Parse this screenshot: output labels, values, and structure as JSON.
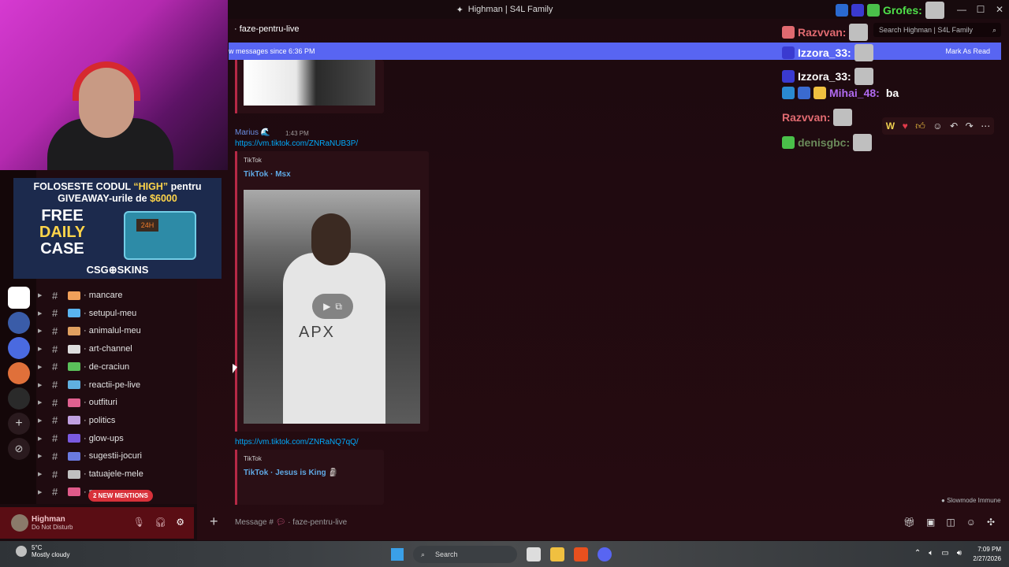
{
  "window": {
    "title": "Highman | S4L Family"
  },
  "header": {
    "channel": "faze-pentru-live",
    "search_placeholder": "Search Highman | S4L Family"
  },
  "banner": {
    "text": "w messages since 6:36 PM",
    "action": "Mark As Read"
  },
  "channels": [
    {
      "name": "mancare",
      "color": "#f0a05a"
    },
    {
      "name": "setupul-meu",
      "color": "#5ab4f0"
    },
    {
      "name": "animalul-meu",
      "color": "#e0a060"
    },
    {
      "name": "art-channel",
      "color": "#dddddd"
    },
    {
      "name": "de-craciun",
      "color": "#5ac05a"
    },
    {
      "name": "reactii-pe-live",
      "color": "#60b0e0"
    },
    {
      "name": "outfituri",
      "color": "#e06090"
    },
    {
      "name": "politics",
      "color": "#c0a0e0"
    },
    {
      "name": "glow-ups",
      "color": "#7a5ae0"
    },
    {
      "name": "sugestii-jocuri",
      "color": "#6a7ae0"
    },
    {
      "name": "tatuajele-mele",
      "color": "#c0c0c0"
    },
    {
      "name": "m",
      "color": "#e05a8a"
    }
  ],
  "mentions_badge": "2 NEW MENTIONS",
  "user": {
    "name": "Highman",
    "status": "Do Not Disturb"
  },
  "ad": {
    "line1_pre": "FOLOSESTE CODUL ",
    "line1_code": "“HIGH”",
    "line1_post": " pentru",
    "line2_pre": "GIVEAWAY-urile de ",
    "line2_amount": "$6000",
    "free": "FREE",
    "daily": "DAILY",
    "case": "CASE",
    "timer": "24H",
    "brand": "CSG⊕SKINS"
  },
  "messages": {
    "author": "Marius",
    "time": "1:43 PM",
    "link1": "https://vm.tiktok.com/ZNRaNUB3P/",
    "provider1": "TikTok",
    "title1": "TikTok · Msx",
    "link2": "https://vm.tiktok.com/ZNRaNQ7qQ/",
    "provider2": "TikTok",
    "title2": "TikTok · Jesus is King"
  },
  "video": {
    "suit_text": "APX"
  },
  "chat_overlay": [
    {
      "user": "Grofes:",
      "color": "#4fe04a",
      "text": ""
    },
    {
      "user": "Razvvan:",
      "color": "#e06a70",
      "text": ""
    },
    {
      "user": "Izzora_33:",
      "color": "#ffffff",
      "text": ""
    },
    {
      "user": "Izzora_33:",
      "color": "#ffffff",
      "text": ""
    },
    {
      "user": "Mihai_48:",
      "color": "#b06af0",
      "text": "ba"
    },
    {
      "user": "Razvvan:",
      "color": "#e06a70",
      "text": ""
    },
    {
      "user": "denisgbc:",
      "color": "#6a8a5a",
      "text": ""
    }
  ],
  "slowmode": "Slowmode Immune",
  "composer": {
    "placeholder": "Message #",
    "channel": "faze-pentru-live"
  },
  "taskbar": {
    "temp": "5°C",
    "weather": "Mostly cloudy",
    "search": "Search",
    "time": "7:09 PM",
    "date": "2/27/2026"
  }
}
